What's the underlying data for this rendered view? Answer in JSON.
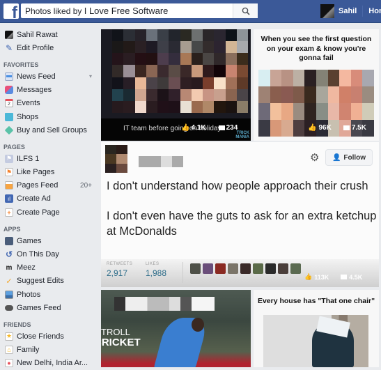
{
  "header": {
    "logo": "f",
    "search_prefix": "Photos liked by ",
    "search_query": "I Love Free Software",
    "user_name": "Sahil",
    "home_label": "Home"
  },
  "sidebar": {
    "profile_name": "Sahil Rawat",
    "edit_profile": "Edit Profile",
    "sections": [
      {
        "title": "FAVORITES",
        "items": [
          {
            "label": "News Feed",
            "icon": "news-feed-icon",
            "extra": "▾"
          },
          {
            "label": "Messages",
            "icon": "messages-icon"
          },
          {
            "label": "Events",
            "icon": "events-icon"
          },
          {
            "label": "Shops",
            "icon": "shops-icon"
          },
          {
            "label": "Buy and Sell Groups",
            "icon": "tag-icon"
          }
        ]
      },
      {
        "title": "PAGES",
        "items": [
          {
            "label": "ILFS 1",
            "icon": "page-icon"
          },
          {
            "label": "Like Pages",
            "icon": "flag-icon"
          },
          {
            "label": "Pages Feed",
            "icon": "pages-feed-icon",
            "count": "20+"
          },
          {
            "label": "Create Ad",
            "icon": "chart-icon"
          },
          {
            "label": "Create Page",
            "icon": "plus-icon"
          }
        ]
      },
      {
        "title": "APPS",
        "items": [
          {
            "label": "Games",
            "icon": "games-icon"
          },
          {
            "label": "On This Day",
            "icon": "history-icon"
          },
          {
            "label": "Meez",
            "icon": "meez-icon"
          },
          {
            "label": "Suggest Edits",
            "icon": "pencil-check-icon"
          },
          {
            "label": "Photos",
            "icon": "photos-icon"
          },
          {
            "label": "Games Feed",
            "icon": "gamepad-icon"
          }
        ]
      },
      {
        "title": "FRIENDS",
        "items": [
          {
            "label": "Close Friends",
            "icon": "star-icon"
          },
          {
            "label": "Family",
            "icon": "home-icon"
          },
          {
            "label": "New Delhi, India Ar...",
            "icon": "location-icon"
          }
        ]
      }
    ]
  },
  "posts": {
    "tile1": {
      "caption": "IT team before going on holiday",
      "likes": "4.1K",
      "comments": "234",
      "watermark": "TRICK MANIA"
    },
    "tile2": {
      "title": "When you see the first question on your exam & know you're gonna fail",
      "likes": "96K",
      "comments": "7.5K"
    },
    "tile3": {
      "follow_label": "Follow",
      "text1": "I don't understand how people approach their crush",
      "text2": "I don't even have the guts to ask for an extra ketchup at McDonalds",
      "retweets_label": "RETWEETS",
      "retweets": "2,917",
      "likes_label": "LIKES",
      "likes_count": "1,988",
      "fb_likes": "113K",
      "fb_comments": "4.5K"
    },
    "tile4": {
      "watermark_line1": "TROLL",
      "watermark_line2": "CRICKET"
    },
    "tile5": {
      "title": "Every house has \"That one chair\""
    }
  },
  "colors": {
    "brand": "#3b5998",
    "link": "#2f6e8a"
  }
}
